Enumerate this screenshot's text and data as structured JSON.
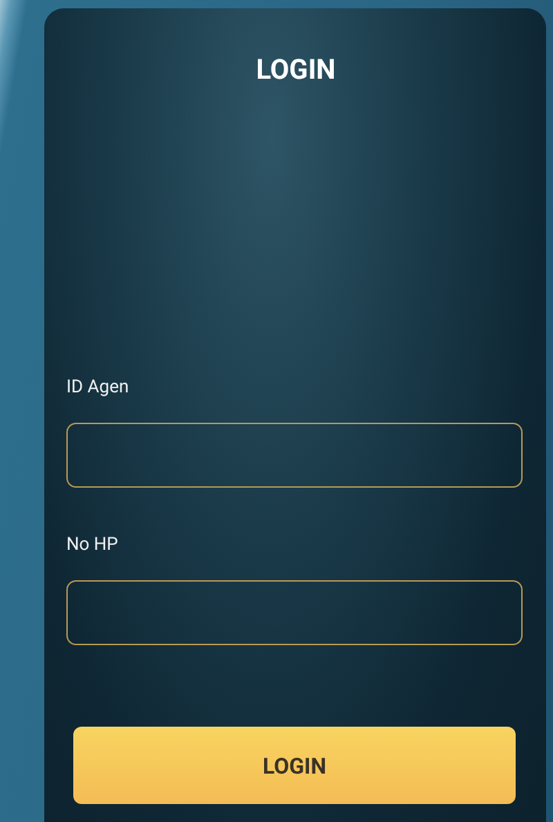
{
  "title": "LOGIN",
  "fields": [
    {
      "label": "ID Agen"
    },
    {
      "label": "No HP"
    }
  ],
  "button": "LOGIN"
}
